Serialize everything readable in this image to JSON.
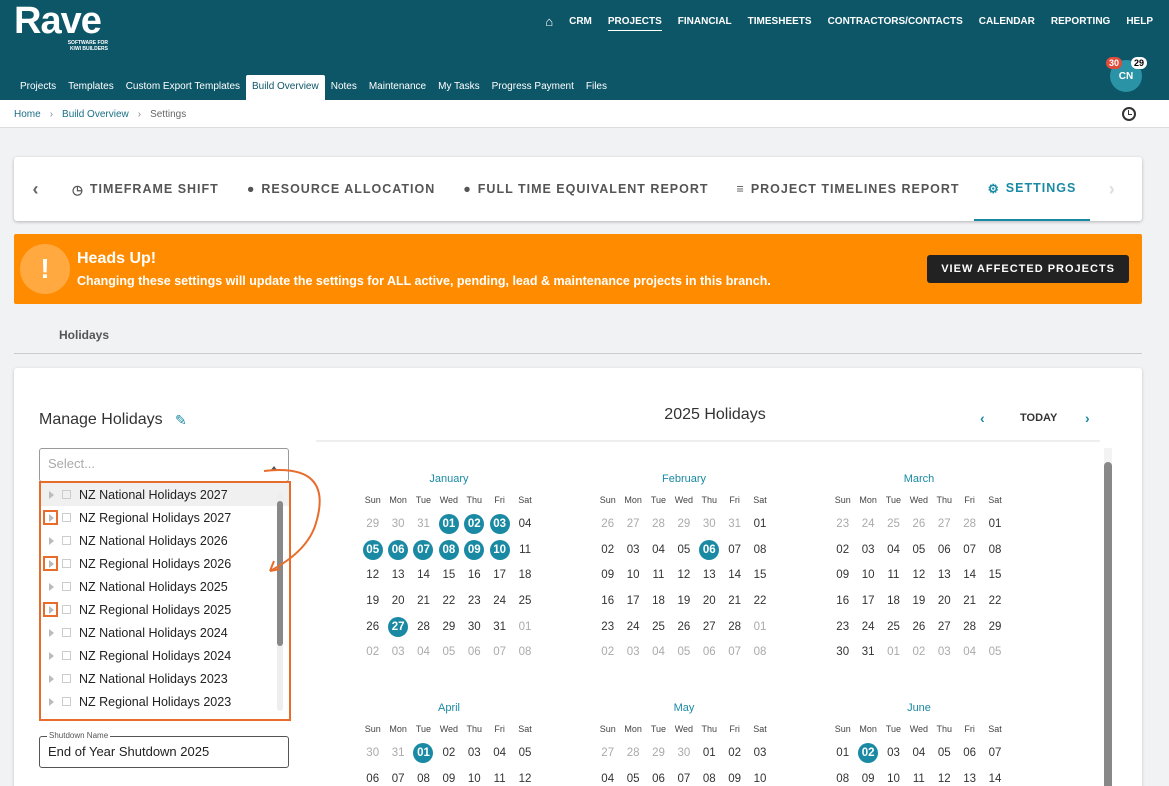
{
  "app": {
    "logo": "Rave",
    "tagline": "SOFTWARE FOR KIWI BUILDERS"
  },
  "nav": [
    "CRM",
    "PROJECTS",
    "FINANCIAL",
    "TIMESHEETS",
    "CONTRACTORS/CONTACTS",
    "CALENDAR",
    "REPORTING",
    "HELP"
  ],
  "tabs": [
    "Projects",
    "Templates",
    "Custom Export Templates",
    "Build Overview",
    "Notes",
    "Maintenance",
    "My Tasks",
    "Progress Payment",
    "Files"
  ],
  "user": {
    "initials": "CN",
    "badge1": "30",
    "badge2": "29"
  },
  "breadcrumb": {
    "home": "Home",
    "parent": "Build Overview",
    "current": "Settings"
  },
  "report_tabs": [
    "TIMEFRAME SHIFT",
    "RESOURCE ALLOCATION",
    "FULL TIME EQUIVALENT REPORT",
    "PROJECT TIMELINES REPORT",
    "SETTINGS"
  ],
  "alert": {
    "title": "Heads Up!",
    "text": "Changing these settings will update the settings for ALL active, pending, lead & maintenance projects in this branch.",
    "button": "VIEW AFFECTED PROJECTS"
  },
  "section": "Holidays",
  "manage": {
    "title": "Manage Holidays",
    "placeholder": "Select...",
    "options": [
      "NZ National Holidays 2027",
      "NZ Regional Holidays 2027",
      "NZ National Holidays 2026",
      "NZ Regional Holidays 2026",
      "NZ National Holidays 2025",
      "NZ Regional Holidays 2025",
      "NZ National Holidays 2024",
      "NZ Regional Holidays 2024",
      "NZ National Holidays 2023",
      "NZ Regional Holidays 2023"
    ],
    "shutdown_label": "Shutdown Name",
    "shutdown_value": "End of Year Shutdown 2025"
  },
  "calendar": {
    "title": "2025 Holidays",
    "today": "TODAY",
    "dow": [
      "Sun",
      "Mon",
      "Tue",
      "Wed",
      "Thu",
      "Fri",
      "Sat"
    ],
    "months": [
      {
        "name": "January",
        "days": [
          "29",
          "30",
          "31",
          "01",
          "02",
          "03",
          "04",
          "05",
          "06",
          "07",
          "08",
          "09",
          "10",
          "11",
          "12",
          "13",
          "14",
          "15",
          "16",
          "17",
          "18",
          "19",
          "20",
          "21",
          "22",
          "23",
          "24",
          "25",
          "26",
          "27",
          "28",
          "29",
          "30",
          "31",
          "01",
          "02",
          "03",
          "04",
          "05",
          "06",
          "07",
          "08"
        ],
        "holidays": [
          3,
          4,
          5,
          7,
          8,
          9,
          10,
          11,
          12,
          29
        ],
        "outside": [
          0,
          1,
          2,
          34,
          35,
          36,
          37,
          38,
          39,
          40,
          41
        ]
      },
      {
        "name": "February",
        "days": [
          "26",
          "27",
          "28",
          "29",
          "30",
          "31",
          "01",
          "02",
          "03",
          "04",
          "05",
          "06",
          "07",
          "08",
          "09",
          "10",
          "11",
          "12",
          "13",
          "14",
          "15",
          "16",
          "17",
          "18",
          "19",
          "20",
          "21",
          "22",
          "23",
          "24",
          "25",
          "26",
          "27",
          "28",
          "01",
          "02",
          "03",
          "04",
          "05",
          "06",
          "07",
          "08"
        ],
        "holidays": [
          11
        ],
        "outside": [
          0,
          1,
          2,
          3,
          4,
          5,
          34,
          35,
          36,
          37,
          38,
          39,
          40,
          41
        ]
      },
      {
        "name": "March",
        "days": [
          "23",
          "24",
          "25",
          "26",
          "27",
          "28",
          "01",
          "02",
          "03",
          "04",
          "05",
          "06",
          "07",
          "08",
          "09",
          "10",
          "11",
          "12",
          "13",
          "14",
          "15",
          "16",
          "17",
          "18",
          "19",
          "20",
          "21",
          "22",
          "23",
          "24",
          "25",
          "26",
          "27",
          "28",
          "29",
          "30",
          "31",
          "01",
          "02",
          "03",
          "04",
          "05"
        ],
        "holidays": [],
        "outside": [
          0,
          1,
          2,
          3,
          4,
          5,
          37,
          38,
          39,
          40,
          41
        ]
      },
      {
        "name": "April",
        "days": [
          "30",
          "31",
          "01",
          "02",
          "03",
          "04",
          "05",
          "06",
          "07",
          "08",
          "09",
          "10",
          "11",
          "12"
        ],
        "holidays": [
          2
        ],
        "outside": [
          0,
          1
        ]
      },
      {
        "name": "May",
        "days": [
          "27",
          "28",
          "29",
          "30",
          "01",
          "02",
          "03",
          "04",
          "05",
          "06",
          "07",
          "08",
          "09",
          "10"
        ],
        "holidays": [],
        "outside": [
          0,
          1,
          2,
          3
        ]
      },
      {
        "name": "June",
        "days": [
          "01",
          "02",
          "03",
          "04",
          "05",
          "06",
          "07",
          "08",
          "09",
          "10",
          "11",
          "12",
          "13",
          "14"
        ],
        "holidays": [
          1
        ],
        "outside": []
      }
    ]
  }
}
